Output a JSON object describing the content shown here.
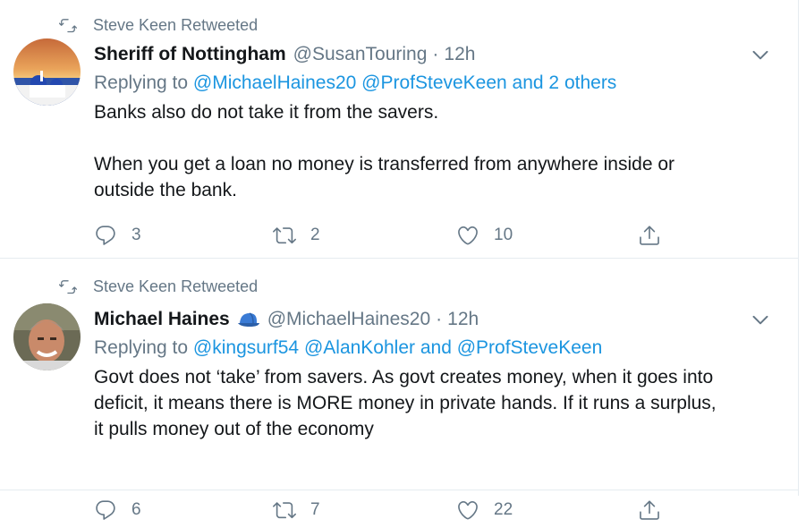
{
  "tweets": [
    {
      "retweeted_by": "Steve Keen Retweeted",
      "name": "Sheriff of Nottingham",
      "handle": "@SusanTouring",
      "dot": "·",
      "time": "12h",
      "reply_prefix": "Replying to",
      "reply_mentions": "@MichaelHaines20 @ProfSteveKeen and 2 others",
      "text_lines": [
        "Banks also do not take it from the savers.",
        "",
        "When you get a loan no money is transferred from anywhere inside or",
        "outside the bank."
      ],
      "reply_count": "3",
      "retweet_count": "2",
      "like_count": "10"
    },
    {
      "retweeted_by": "Steve Keen Retweeted",
      "name": "Michael Haines",
      "handle": "@MichaelHaines20",
      "dot": "·",
      "time": "12h",
      "reply_prefix": "Replying to",
      "reply_mentions": "@kingsurf54 @AlanKohler and @ProfSteveKeen",
      "text_lines": [
        "Govt does not ‘take’ from savers.  As govt creates money, when it goes into",
        "deficit, it means there is MORE money in private hands. If it runs a surplus,",
        "it pulls money out of the economy"
      ],
      "reply_count": "6",
      "retweet_count": "7",
      "like_count": "22"
    }
  ],
  "colors": {
    "accent": "#1b95e0",
    "muted": "#657786",
    "text": "#14171a",
    "border": "#e6ecf0"
  },
  "icons": [
    "retweet-icon",
    "chevron-down-icon",
    "reply-icon",
    "like-icon",
    "share-icon",
    "cap-icon"
  ]
}
